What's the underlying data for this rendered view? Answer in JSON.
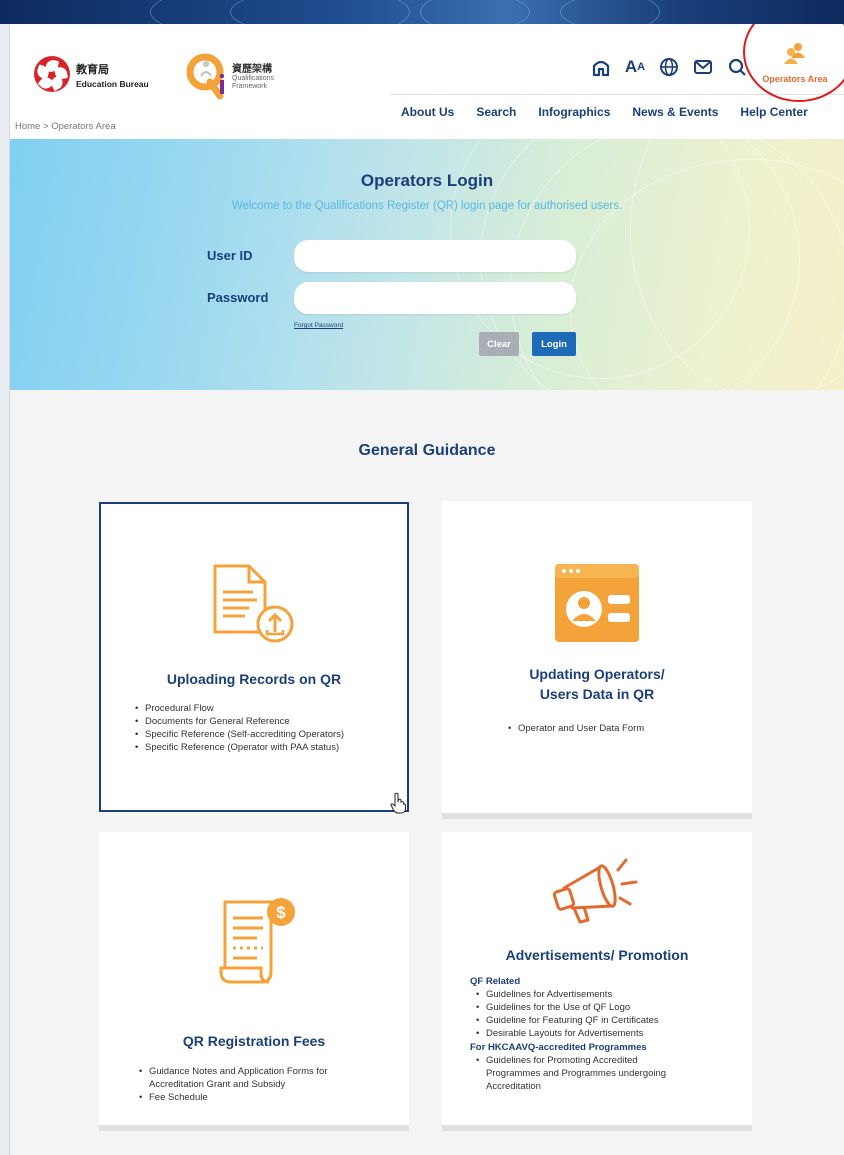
{
  "branding": {
    "edb_name_zh": "教育局",
    "edb_name_en": "Education Bureau",
    "qf_name_zh": "資歷架構",
    "qf_name_en_line1": "Qualifications",
    "qf_name_en_line2": "Framework"
  },
  "utility": {
    "home_icon": "home-icon",
    "text_size_label": "A",
    "text_size_small": "A",
    "language_icon": "globe-icon",
    "mail_icon": "mail-icon",
    "search_icon": "search-icon",
    "operators_area_label": "Operators Area"
  },
  "nav": {
    "items": [
      "About Us",
      "Search",
      "Infographics",
      "News & Events",
      "Help Center"
    ]
  },
  "breadcrumb": {
    "home": "Home",
    "separator": ">",
    "current": "Operators Area"
  },
  "login": {
    "title": "Operators Login",
    "subtitle": "Welcome to the Qualifications Register (QR) login page for authorised users.",
    "user_id_label": "User ID",
    "user_id_value": "",
    "password_label": "Password",
    "password_value": "",
    "forgot_password": "Forgot Password",
    "clear_button": "Clear",
    "login_button": "Login"
  },
  "guidance": {
    "title": "General Guidance",
    "cards": [
      {
        "icon": "document-upload-icon",
        "title": "Uploading Records on QR",
        "items": [
          "Procedural Flow",
          "Documents for General Reference",
          "Specific Reference (Self-accrediting Operators)",
          "Specific Reference (Operator with PAA status)"
        ]
      },
      {
        "icon": "user-profile-window-icon",
        "title_line1": "Updating Operators/",
        "title_line2": "Users Data in QR",
        "items": [
          "Operator and User Data Form"
        ]
      },
      {
        "icon": "fee-document-icon",
        "title": "QR Registration Fees",
        "items": [
          "Guidance Notes and Application Forms for",
          "Accreditation Grant and Subsidy",
          "Fee Schedule"
        ]
      },
      {
        "icon": "megaphone-icon",
        "title": "Advertisements/ Promotion",
        "group1_heading": "QF Related",
        "group1_items": [
          "Guidelines for Advertisements",
          "Guidelines for the Use of QF Logo",
          "Guideline for Featuring QF in Certificates",
          "Desirable Layouts for Advertisements"
        ],
        "group2_heading": "For HKCAAVQ-accredited Programmes",
        "group2_items": [
          "Guidelines for Promoting Accredited",
          "Programmes and Programmes undergoing",
          "Accreditation"
        ]
      }
    ]
  },
  "colors": {
    "brand_navy": "#1b3f7a",
    "accent_orange": "#f4a23a",
    "operators_orange": "#e36a2e",
    "login_blue": "#1c6ab8",
    "highlight_red": "#e11a1a"
  }
}
